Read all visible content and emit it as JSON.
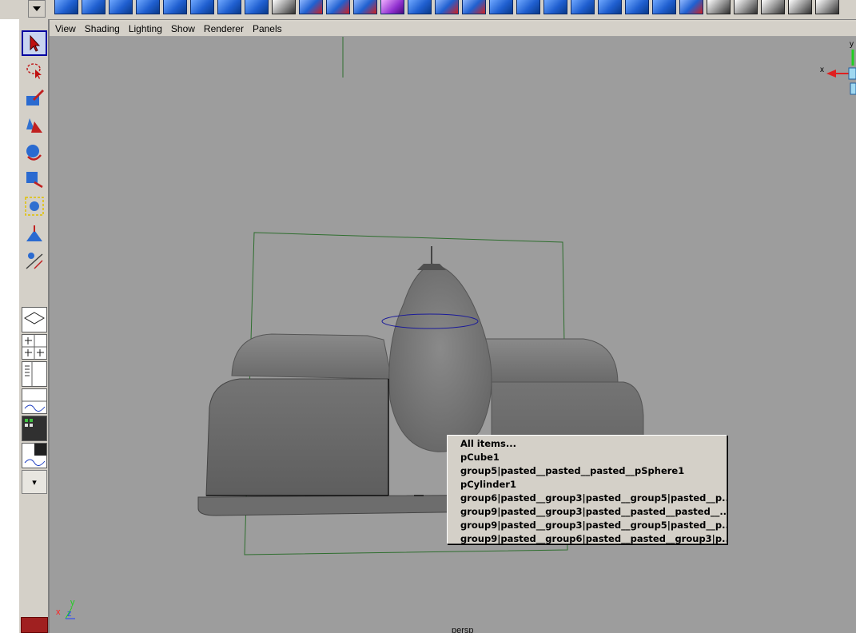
{
  "viewport_menu": {
    "items": [
      "View",
      "Shading",
      "Lighting",
      "Show",
      "Renderer",
      "Panels"
    ]
  },
  "viewport": {
    "camera_label": "persp",
    "axis": {
      "x": "x",
      "y": "y",
      "z": "z"
    },
    "view_cube": {
      "x": "x",
      "y": "y"
    }
  },
  "selection_popup": {
    "items": [
      "All items...",
      "pCube1",
      "group5|pasted__pasted__pasted__pSphere1",
      "pCylinder1",
      "group6|pasted__group3|pasted__group5|pasted__p...",
      "group9|pasted__group3|pasted__pasted__pasted__...",
      "group9|pasted__group3|pasted__group5|pasted__p...",
      "group9|pasted__group6|pasted__pasted__group3|p..."
    ]
  },
  "toolbox": {
    "tools": [
      "select-tool-icon",
      "lasso-tool-icon",
      "paint-select-tool-icon",
      "move-tool-icon",
      "rotate-tool-icon",
      "scale-tool-icon",
      "manipulator-tool-icon",
      "soft-mod-tool-icon",
      "last-tool-icon"
    ],
    "expand_glyph": "▾"
  },
  "colors": {
    "viewport_bg": "#9d9d9d",
    "bounding_box": "#2e6e2e",
    "selection_ring": "#1a1a9a",
    "axis_x": "#ff2020",
    "axis_y": "#20d020",
    "axis_z": "#2040ff"
  }
}
